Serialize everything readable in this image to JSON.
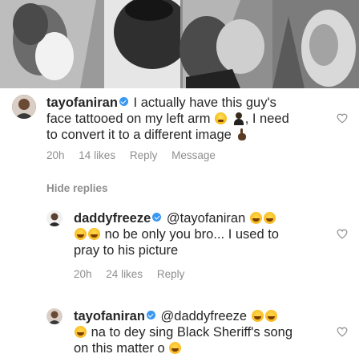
{
  "comments": [
    {
      "handle": "tayofaniran",
      "text_1": "I actually have this guy's",
      "text_2": "face tattooed on my left arm",
      "text_2b": ", I need",
      "text_3": "to convert it to a different image",
      "time": "20h",
      "likes": "14 likes",
      "reply": "Reply",
      "message": "Message"
    },
    {
      "handle": "daddyfreeze",
      "mention": "@tayofaniran",
      "text_2": "no be only you bro... I used to",
      "text_3": "pray to his picture",
      "time": "20h",
      "likes": "24 likes",
      "reply": "Reply"
    },
    {
      "handle": "tayofaniran",
      "mention": "@daddyfreeze",
      "text_2": "na to dey sing Black Sheriff's song",
      "text_3": "on this matter o"
    }
  ],
  "hide_replies": "Hide replies",
  "icons": {
    "verified": "verified-badge-icon",
    "heart": "heart-icon",
    "laugh": "laughing-emoji-icon"
  },
  "colors": {
    "text": "#262626",
    "secondary": "#8e8e8e",
    "verified": "#3897f0"
  }
}
